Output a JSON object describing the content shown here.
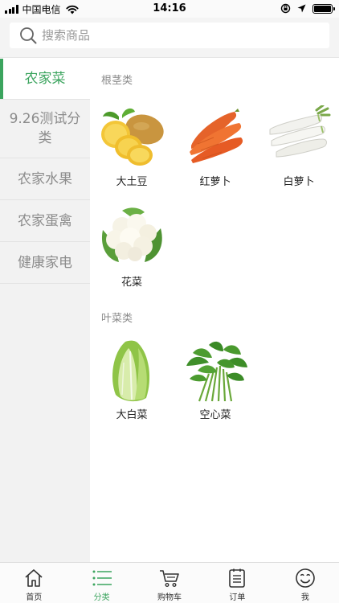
{
  "status_bar": {
    "carrier": "中国电信",
    "time": "14:16"
  },
  "search": {
    "placeholder": "搜索商品",
    "value": ""
  },
  "sidebar": {
    "items": [
      {
        "label": "农家菜",
        "active": true
      },
      {
        "label": "9.26测试分类",
        "active": false
      },
      {
        "label": "农家水果",
        "active": false
      },
      {
        "label": "农家蛋禽",
        "active": false
      },
      {
        "label": "健康家电",
        "active": false
      }
    ]
  },
  "sections": [
    {
      "title": "根茎类",
      "products": [
        {
          "name": "大土豆",
          "icon": "potato-image"
        },
        {
          "name": "红萝卜",
          "icon": "carrot-image"
        },
        {
          "name": "白萝卜",
          "icon": "white-radish-image"
        },
        {
          "name": "花菜",
          "icon": "cauliflower-image"
        }
      ]
    },
    {
      "title": "叶菜类",
      "products": [
        {
          "name": "大白菜",
          "icon": "napa-cabbage-image"
        },
        {
          "name": "空心菜",
          "icon": "water-spinach-image"
        }
      ]
    }
  ],
  "tabbar": {
    "items": [
      {
        "label": "首页",
        "icon": "home-icon"
      },
      {
        "label": "分类",
        "icon": "category-list-icon",
        "active": true
      },
      {
        "label": "购物车",
        "icon": "cart-icon"
      },
      {
        "label": "订单",
        "icon": "order-icon"
      },
      {
        "label": "我",
        "icon": "smiley-profile-icon"
      }
    ]
  },
  "colors": {
    "accent": "#3ba45e",
    "sidebar_bg": "#f2f2f2",
    "muted_text": "#8c8c8c"
  }
}
